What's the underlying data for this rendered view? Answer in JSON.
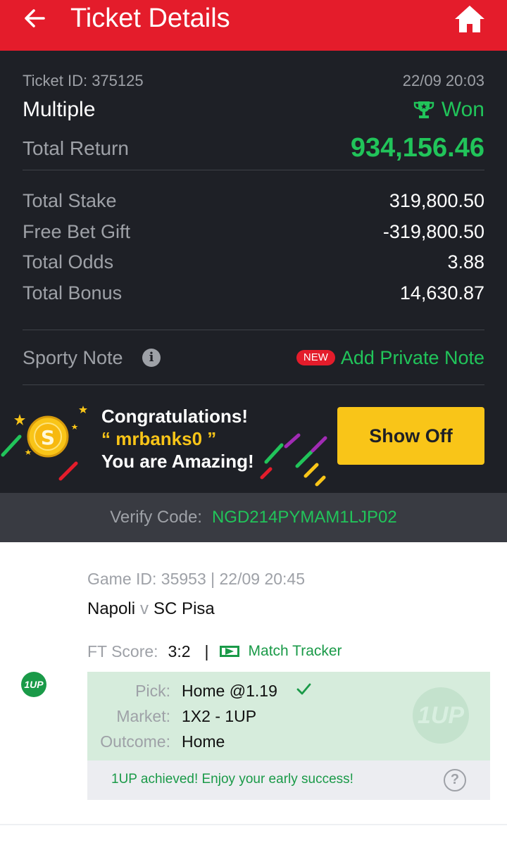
{
  "header": {
    "title": "Ticket Details",
    "back_icon": "arrow-left-icon",
    "home_icon": "home-icon",
    "color": "#e41c2b"
  },
  "ticket": {
    "id_label": "Ticket ID: 375125",
    "date": "22/09 20:03",
    "type": "Multiple",
    "status": "Won",
    "status_icon": "trophy-icon",
    "total_return_label": "Total Return",
    "total_return": "934,156.46"
  },
  "summary": [
    {
      "label": "Total Stake",
      "value": "319,800.50"
    },
    {
      "label": "Free Bet Gift",
      "value": "-319,800.50"
    },
    {
      "label": "Total Odds",
      "value": "3.88"
    },
    {
      "label": "Total Bonus",
      "value": "14,630.87"
    }
  ],
  "note": {
    "label": "Sporty Note",
    "badge": "NEW",
    "action": "Add Private Note"
  },
  "promo": {
    "line1": "Congratulations!",
    "username": "“ mrbanks0 ”",
    "line3": "You are Amazing!",
    "button": "Show Off",
    "coin_symbol": "S"
  },
  "verify": {
    "label": "Verify Code:",
    "code": "NGD214PYMAM1LJP02"
  },
  "game": {
    "meta": "Game ID: 35953 | 22/09 20:45",
    "home_team": "Napoli",
    "vs": "v",
    "away_team": "SC Pisa",
    "ft_label": "FT Score:",
    "ft_score": "3:2",
    "separator": "|",
    "tracker": "Match Tracker",
    "badge": "1UP",
    "pick_label": "Pick:",
    "pick_value": "Home @1.19",
    "market_label": "Market:",
    "market_value": "1X2 - 1UP",
    "outcome_label": "Outcome:",
    "outcome_value": "Home",
    "watermark": "1UP",
    "achieved": "1UP achieved! Enjoy your early success!",
    "help": "?"
  },
  "colors": {
    "won_green": "#21c45a",
    "dark_bg": "#1e2026",
    "accent_yellow": "#f9c518",
    "pick_bg": "#d6ecdc"
  }
}
